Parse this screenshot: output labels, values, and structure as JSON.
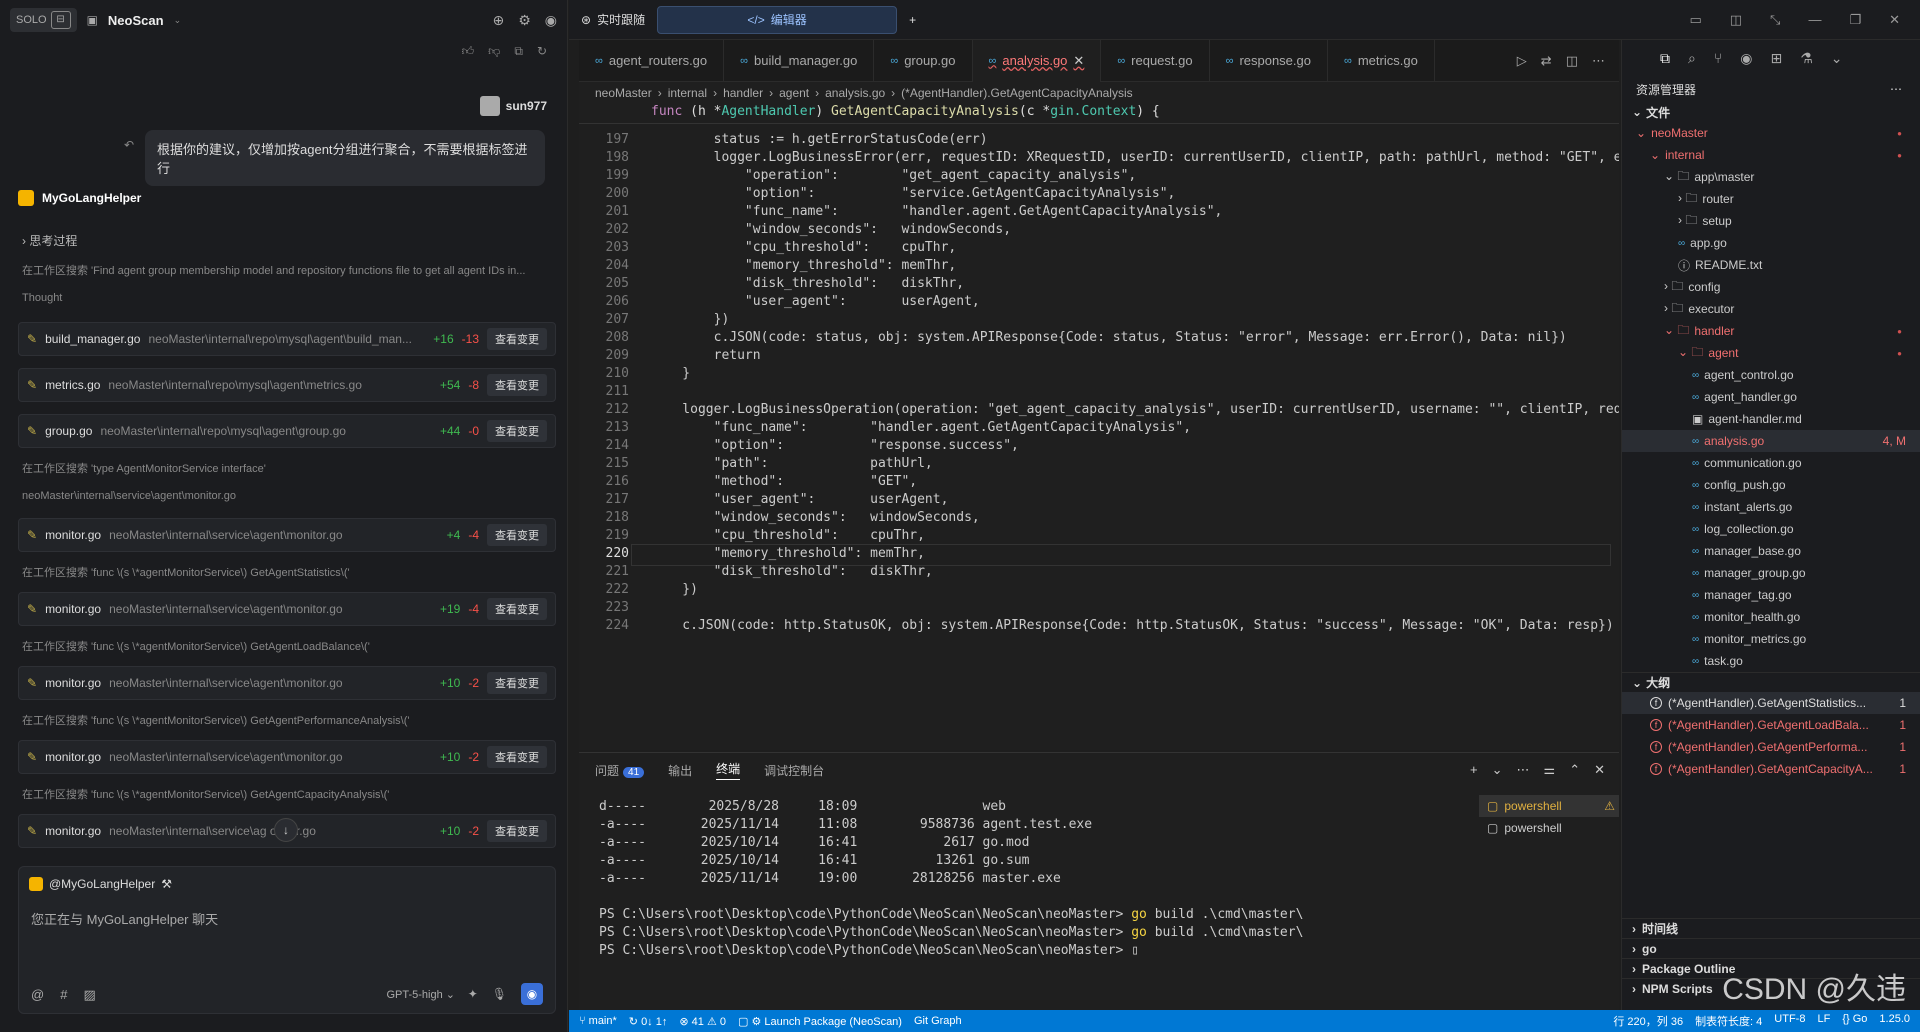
{
  "left": {
    "solo_label": "SOLO",
    "project": "NeoScan",
    "username": "sun977",
    "user_message": "根据你的建议，仅增加按agent分组进行聚合，不需要根据标签进行",
    "assistant": "MyGoLangHelper",
    "thinking": "思考过程",
    "thought": "Thought",
    "steps": [
      "在工作区搜索 'Find agent group membership model and repository functions file to get all agent IDs in...",
      "在工作区搜索 'type AgentMonitorService interface'",
      "neoMaster\\internal\\service\\agent\\monitor.go",
      "在工作区搜索 'func \\(s \\*agentMonitorService\\) GetAgentStatistics\\('",
      "在工作区搜索 'func \\(s \\*agentMonitorService\\) GetAgentLoadBalance\\('",
      "在工作区搜索 'func \\(s \\*agentMonitorService\\) GetAgentPerformanceAnalysis\\('",
      "在工作区搜索 'func \\(s \\*agentMonitorService\\) GetAgentCapacityAnalysis\\('"
    ],
    "cards": [
      {
        "file": "build_manager.go",
        "path": "neoMaster\\internal\\repo\\mysql\\agent\\build_man...",
        "add": "+16",
        "del": "-13"
      },
      {
        "file": "metrics.go",
        "path": "neoMaster\\internal\\repo\\mysql\\agent\\metrics.go",
        "add": "+54",
        "del": "-8"
      },
      {
        "file": "group.go",
        "path": "neoMaster\\internal\\repo\\mysql\\agent\\group.go",
        "add": "+44",
        "del": "-0"
      },
      {
        "file": "monitor.go",
        "path": "neoMaster\\internal\\service\\agent\\monitor.go",
        "add": "+4",
        "del": "-4"
      },
      {
        "file": "monitor.go",
        "path": "neoMaster\\internal\\service\\agent\\monitor.go",
        "add": "+19",
        "del": "-4"
      },
      {
        "file": "monitor.go",
        "path": "neoMaster\\internal\\service\\agent\\monitor.go",
        "add": "+10",
        "del": "-2"
      },
      {
        "file": "monitor.go",
        "path": "neoMaster\\internal\\service\\agent\\monitor.go",
        "add": "+10",
        "del": "-2"
      },
      {
        "file": "monitor.go",
        "path": "neoMaster\\internal\\service\\ag   onitor.go",
        "add": "+10",
        "del": "-2"
      }
    ],
    "view_changes": "查看变更",
    "mention": "@MyGoLangHelper",
    "placeholder": "您正在与 MyGoLangHelper 聊天",
    "model": "GPT-5-high"
  },
  "top": {
    "tab_realtime": "实时跟随",
    "tab_editor": "编辑器"
  },
  "editor": {
    "tabs": [
      "agent_routers.go",
      "build_manager.go",
      "group.go",
      "analysis.go",
      "request.go",
      "response.go",
      "metrics.go"
    ],
    "active_tab": "analysis.go",
    "breadcrumb": [
      "neoMaster",
      "internal",
      "handler",
      "agent",
      "analysis.go",
      "(*AgentHandler).GetAgentCapacityAnalysis"
    ],
    "lines": [
      {
        "n": "197",
        "t": "        status := h.getErrorStatusCode(err)"
      },
      {
        "n": "198",
        "t": "        logger.LogBusinessError(err, requestID: XRequestID, userID: currentUserID, clientIP, path: pathUrl, method: \"GET\", ext"
      },
      {
        "n": "199",
        "t": "            \"operation\":        \"get_agent_capacity_analysis\","
      },
      {
        "n": "200",
        "t": "            \"option\":           \"service.GetAgentCapacityAnalysis\","
      },
      {
        "n": "201",
        "t": "            \"func_name\":        \"handler.agent.GetAgentCapacityAnalysis\","
      },
      {
        "n": "202",
        "t": "            \"window_seconds\":   windowSeconds,"
      },
      {
        "n": "203",
        "t": "            \"cpu_threshold\":    cpuThr,"
      },
      {
        "n": "204",
        "t": "            \"memory_threshold\": memThr,"
      },
      {
        "n": "205",
        "t": "            \"disk_threshold\":   diskThr,"
      },
      {
        "n": "206",
        "t": "            \"user_agent\":       userAgent,"
      },
      {
        "n": "207",
        "t": "        })"
      },
      {
        "n": "208",
        "t": "        c.JSON(code: status, obj: system.APIResponse{Code: status, Status: \"error\", Message: err.Error(), Data: nil})"
      },
      {
        "n": "209",
        "t": "        return"
      },
      {
        "n": "210",
        "t": "    }"
      },
      {
        "n": "211",
        "t": ""
      },
      {
        "n": "212",
        "t": "    logger.LogBusinessOperation(operation: \"get_agent_capacity_analysis\", userID: currentUserID, username: \"\", clientIP, requ"
      },
      {
        "n": "213",
        "t": "        \"func_name\":        \"handler.agent.GetAgentCapacityAnalysis\","
      },
      {
        "n": "214",
        "t": "        \"option\":           \"response.success\","
      },
      {
        "n": "215",
        "t": "        \"path\":             pathUrl,"
      },
      {
        "n": "216",
        "t": "        \"method\":           \"GET\","
      },
      {
        "n": "217",
        "t": "        \"user_agent\":       userAgent,"
      },
      {
        "n": "218",
        "t": "        \"window_seconds\":   windowSeconds,"
      },
      {
        "n": "219",
        "t": "        \"cpu_threshold\":    cpuThr,"
      },
      {
        "n": "220",
        "t": "        \"memory_threshold\": memThr,"
      },
      {
        "n": "221",
        "t": "        \"disk_threshold\":   diskThr,"
      },
      {
        "n": "222",
        "t": "    })"
      },
      {
        "n": "223",
        "t": ""
      },
      {
        "n": "224",
        "t": "    c.JSON(code: http.StatusOK, obj: system.APIResponse{Code: http.StatusOK, Status: \"success\", Message: \"OK\", Data: resp})"
      }
    ],
    "current_line": "220"
  },
  "panel": {
    "tab_problems": "问题",
    "problems_count": "41",
    "tab_output": "输出",
    "tab_terminal": "终端",
    "tab_debug": "调试控制台",
    "terminal": [
      "d-----        2025/8/28     18:09                web",
      "-a----       2025/11/14     11:08        9588736 agent.test.exe",
      "-a----       2025/10/14     16:41           2617 go.mod",
      "-a----       2025/10/14     16:41          13261 go.sum",
      "-a----       2025/11/14     19:00       28128256 master.exe",
      "",
      "PS C:\\Users\\root\\Desktop\\code\\PythonCode\\NeoScan\\NeoScan\\neoMaster> go build .\\cmd\\master\\",
      "PS C:\\Users\\root\\Desktop\\code\\PythonCode\\NeoScan\\NeoScan\\neoMaster> go build .\\cmd\\master\\",
      "PS C:\\Users\\root\\Desktop\\code\\PythonCode\\NeoScan\\NeoScan\\neoMaster> ▯"
    ],
    "shells": [
      "powershell",
      "powershell"
    ]
  },
  "right": {
    "title": "资源管理器",
    "files_section": "文件",
    "outline_section": "大纲",
    "tree": [
      {
        "d": 0,
        "icon": "⌄",
        "label": "neoMaster",
        "red": true,
        "dot": true
      },
      {
        "d": 1,
        "icon": "⌄",
        "label": "internal",
        "red": true,
        "dot": true
      },
      {
        "d": 2,
        "icon": "⌄ 🗀",
        "label": "app\\master"
      },
      {
        "d": 3,
        "icon": "› 🗀",
        "label": "router"
      },
      {
        "d": 3,
        "icon": "› 🗀",
        "label": "setup"
      },
      {
        "d": 3,
        "icon": "go",
        "label": "app.go"
      },
      {
        "d": 3,
        "icon": "ⓘ",
        "label": "README.txt"
      },
      {
        "d": 2,
        "icon": "› 🗀",
        "label": "config"
      },
      {
        "d": 2,
        "icon": "› 🗀",
        "label": "executor"
      },
      {
        "d": 2,
        "icon": "⌄ 🗀",
        "label": "handler",
        "red": true,
        "dot": true
      },
      {
        "d": 3,
        "icon": "⌄ 🗀",
        "label": "agent",
        "red": true,
        "dot": true
      },
      {
        "d": 4,
        "icon": "go",
        "label": "agent_control.go"
      },
      {
        "d": 4,
        "icon": "go",
        "label": "agent_handler.go"
      },
      {
        "d": 4,
        "icon": "▣",
        "label": "agent-handler.md"
      },
      {
        "d": 4,
        "icon": "go",
        "label": "analysis.go",
        "red": true,
        "sel": true,
        "badge": "4, M"
      },
      {
        "d": 4,
        "icon": "go",
        "label": "communication.go"
      },
      {
        "d": 4,
        "icon": "go",
        "label": "config_push.go"
      },
      {
        "d": 4,
        "icon": "go",
        "label": "instant_alerts.go"
      },
      {
        "d": 4,
        "icon": "go",
        "label": "log_collection.go"
      },
      {
        "d": 4,
        "icon": "go",
        "label": "manager_base.go"
      },
      {
        "d": 4,
        "icon": "go",
        "label": "manager_group.go"
      },
      {
        "d": 4,
        "icon": "go",
        "label": "manager_tag.go"
      },
      {
        "d": 4,
        "icon": "go",
        "label": "monitor_health.go"
      },
      {
        "d": 4,
        "icon": "go",
        "label": "monitor_metrics.go"
      },
      {
        "d": 4,
        "icon": "go",
        "label": "task.go"
      }
    ],
    "outline": [
      {
        "label": "(*AgentHandler).GetAgentStatistics...",
        "n": "1",
        "red": false,
        "sel": true
      },
      {
        "label": "(*AgentHandler).GetAgentLoadBala...",
        "n": "1",
        "red": true
      },
      {
        "label": "(*AgentHandler).GetAgentPerforma...",
        "n": "1",
        "red": true
      },
      {
        "label": "(*AgentHandler).GetAgentCapacityA...",
        "n": "1",
        "red": true
      }
    ],
    "bottom": [
      "时间线",
      "go",
      "Package Outline",
      "NPM Scripts"
    ],
    "watermark": "CSDN @久违"
  },
  "status": {
    "branch": "main*",
    "sync": "0↓ 1↑",
    "errors": "41",
    "warnings": "0",
    "launch": "Launch Package (NeoScan)",
    "git_graph": "Git Graph",
    "position": "行 220，列 36",
    "indent": "制表符长度: 4",
    "encoding": "UTF-8",
    "eol": "LF",
    "lang": "Go",
    "go_version": "1.25.0"
  }
}
